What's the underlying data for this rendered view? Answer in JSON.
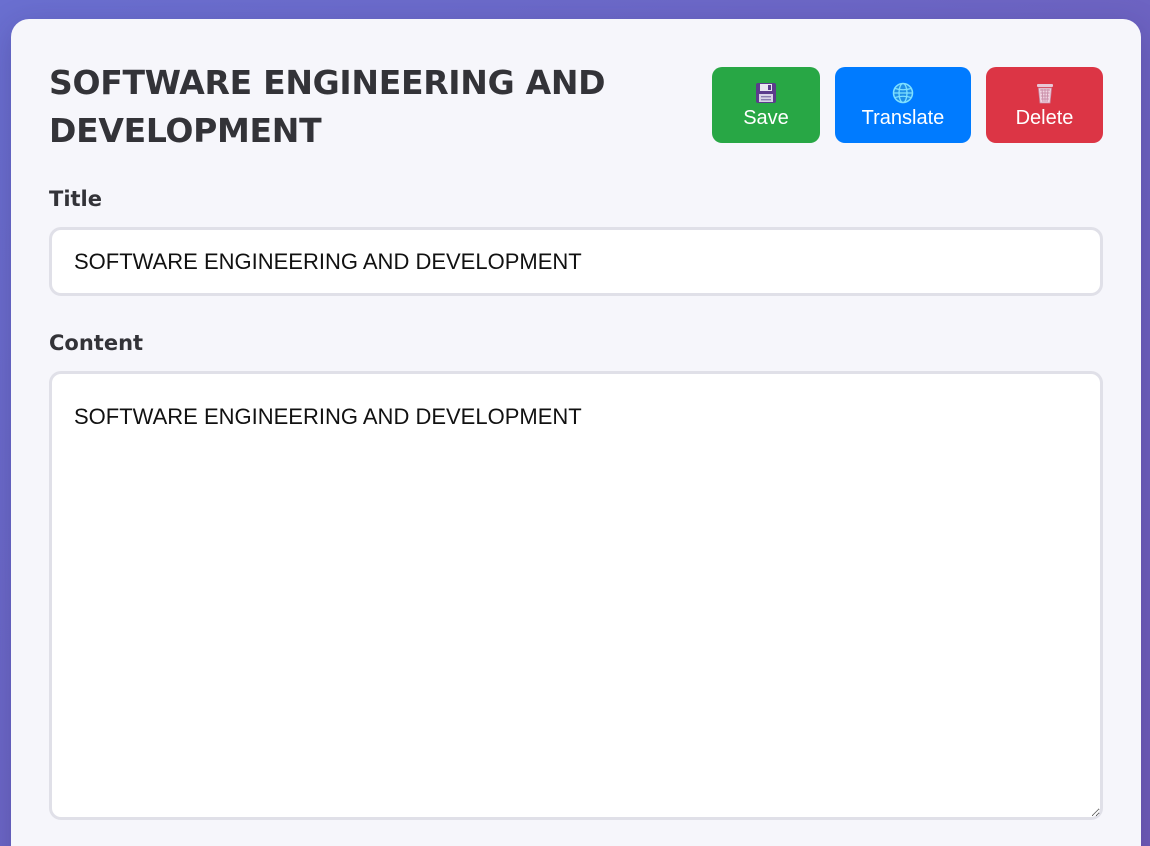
{
  "editor": {
    "heading": "SOFTWARE ENGINEERING AND DEVELOPMENT",
    "actions": {
      "save_label": "Save",
      "save_icon": "floppy-disk-icon",
      "translate_label": "Translate",
      "translate_icon": "globe-icon",
      "delete_label": "Delete",
      "delete_icon": "wastebasket-icon"
    },
    "title_field": {
      "label": "Title",
      "value": "SOFTWARE ENGINEERING AND DEVELOPMENT"
    },
    "content_field": {
      "label": "Content",
      "value": "SOFTWARE ENGINEERING AND DEVELOPMENT"
    }
  },
  "colors": {
    "save": "#28a745",
    "translate": "#007bff",
    "delete": "#dc3545",
    "background_start": "#6a6fd0",
    "background_end": "#6f5bb8"
  }
}
